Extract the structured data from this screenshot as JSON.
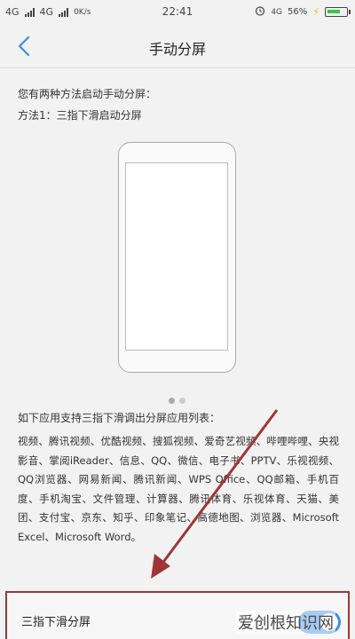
{
  "status_bar": {
    "network1": "4G",
    "network2": "4G",
    "speed": "0K/s",
    "time": "22:41",
    "lte": "4G",
    "battery_percent": "56%"
  },
  "header": {
    "title": "手动分屏"
  },
  "intro": {
    "line1": "您有两种方法启动手动分屏：",
    "line2": "方法1：三指下滑启动分屏"
  },
  "carousel": {
    "page_count": 2,
    "current_page": 1
  },
  "support": {
    "title": "如下应用支持三指下滑调出分屏应用列表：",
    "apps_text": "视频、腾讯视频、优酷视频、搜狐视频、爱奇艺视频、哔哩哔哩、央视影音、掌阅iReader、信息、QQ、微信、电子书、PPTV、乐视视频、QQ浏览器、网易新闻、腾讯新闻、WPS Office、QQ邮箱、手机百度、手机淘宝、文件管理、计算器、腾讯体育、乐视体育、天猫、美团、支付宝、京东、知乎、印象笔记、高德地图、浏览器、Microsoft Excel、Microsoft Word。"
  },
  "setting": {
    "label": "三指下滑分屏",
    "enabled": true
  },
  "watermark": {
    "text": "爱创根知识网"
  },
  "colors": {
    "background": "#f2f2f2",
    "annotation_red": "#a03535",
    "toggle_blue": "#3a8ee6",
    "battery_green": "#3ac24a"
  }
}
